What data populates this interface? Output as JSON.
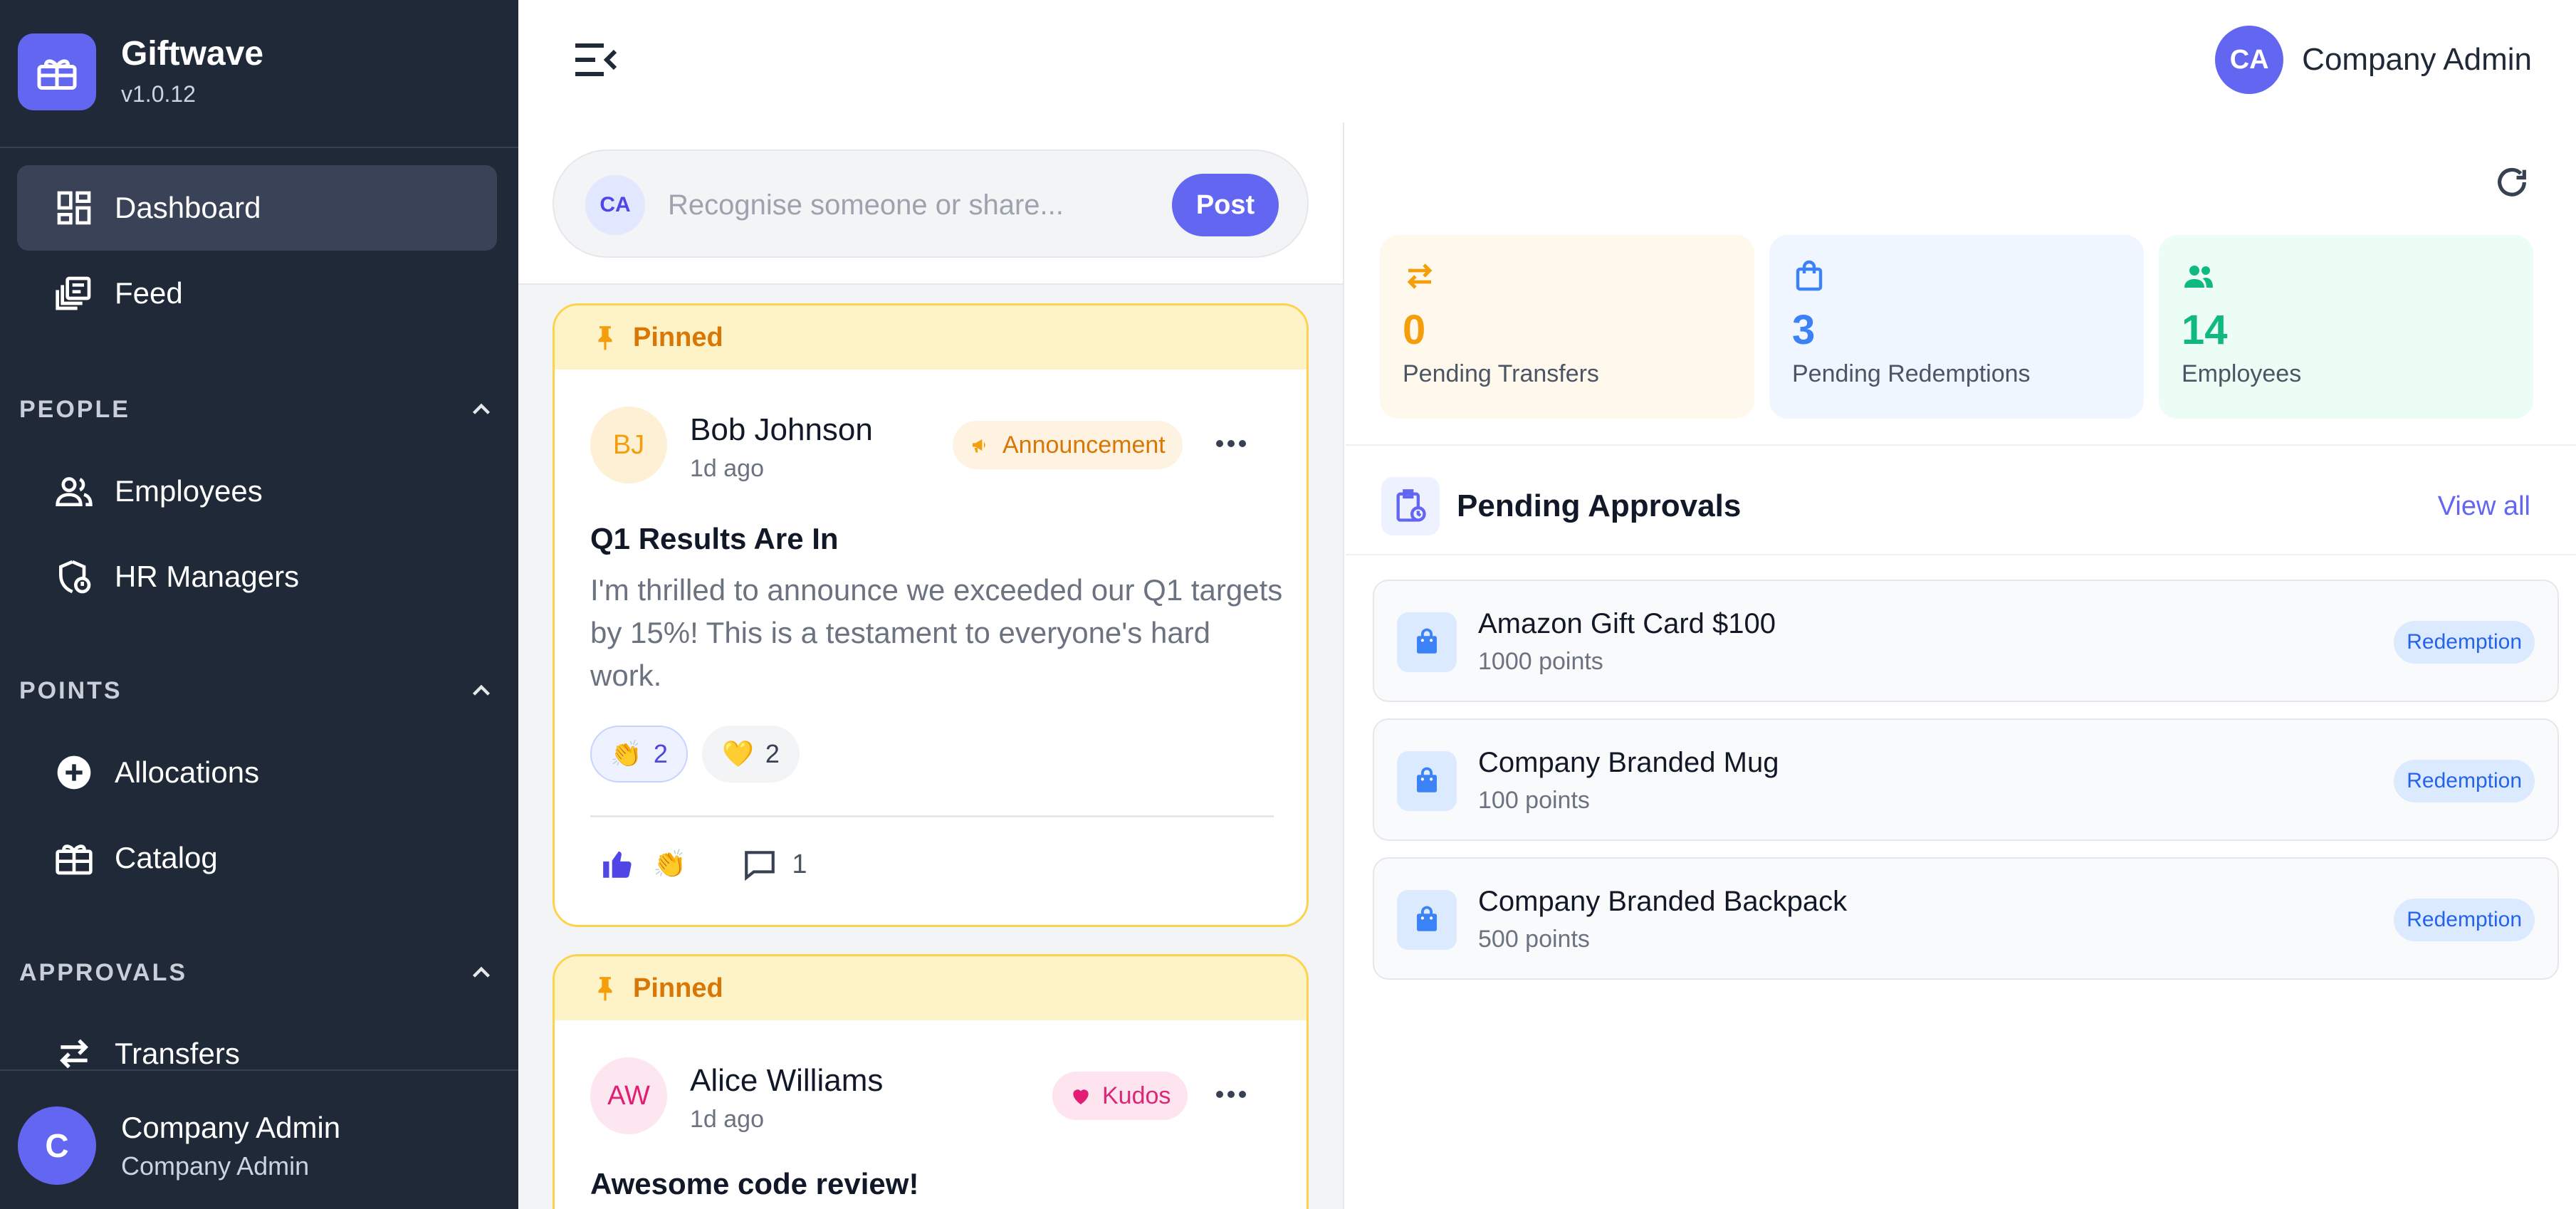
{
  "app": {
    "name": "Giftwave",
    "version": "v1.0.12"
  },
  "sidebar": {
    "nav": [
      {
        "label": "Dashboard",
        "icon": "dashboard-icon",
        "active": true
      },
      {
        "label": "Feed",
        "icon": "feed-icon",
        "active": false
      }
    ],
    "sections": [
      {
        "title": "PEOPLE",
        "items": [
          {
            "label": "Employees",
            "icon": "people-icon"
          },
          {
            "label": "HR Managers",
            "icon": "manager-icon"
          }
        ]
      },
      {
        "title": "POINTS",
        "items": [
          {
            "label": "Allocations",
            "icon": "add-circle-icon"
          },
          {
            "label": "Catalog",
            "icon": "gift-icon"
          }
        ]
      },
      {
        "title": "APPROVALS",
        "items": [
          {
            "label": "Transfers",
            "icon": "transfer-icon"
          }
        ]
      }
    ],
    "user": {
      "initial": "C",
      "name": "Company Admin",
      "role": "Company Admin"
    }
  },
  "topbar": {
    "user_initials": "CA",
    "user_name": "Company Admin"
  },
  "composer": {
    "avatar_initials": "CA",
    "placeholder": "Recognise someone or share...",
    "post_label": "Post"
  },
  "posts": [
    {
      "pinned_label": "Pinned",
      "author_initials": "BJ",
      "author": "Bob Johnson",
      "time": "1d ago",
      "tag": "Announcement",
      "title": "Q1 Results Are In",
      "body": "I'm thrilled to announce we exceeded our Q1 targets by 15%! This is a testament to everyone's hard work.",
      "reactions": [
        {
          "emoji": "👏",
          "count": "2",
          "mine": true
        },
        {
          "emoji": "💛",
          "count": "2",
          "mine": false
        }
      ],
      "action_emoji": "👏",
      "comment_count": "1"
    },
    {
      "pinned_label": "Pinned",
      "author_initials": "AW",
      "author": "Alice Williams",
      "time": "1d ago",
      "tag": "Kudos",
      "title": "Awesome code review!"
    }
  ],
  "stats": [
    {
      "value": "0",
      "label": "Pending Transfers",
      "color": "#f59e0b",
      "bg": "#fff8ed",
      "icon": "transfer-icon"
    },
    {
      "value": "3",
      "label": "Pending Redemptions",
      "color": "#3b82f6",
      "bg": "#eff6ff",
      "icon": "shopping-bag-icon"
    },
    {
      "value": "14",
      "label": "Employees",
      "color": "#10b981",
      "bg": "#ecfdf5",
      "icon": "people-icon"
    }
  ],
  "approvals": {
    "title": "Pending Approvals",
    "view_all": "View all",
    "items": [
      {
        "title": "Amazon Gift Card $100",
        "points": "1000 points",
        "badge": "Redemption"
      },
      {
        "title": "Company Branded Mug",
        "points": "100 points",
        "badge": "Redemption"
      },
      {
        "title": "Company Branded Backpack",
        "points": "500 points",
        "badge": "Redemption"
      }
    ]
  }
}
